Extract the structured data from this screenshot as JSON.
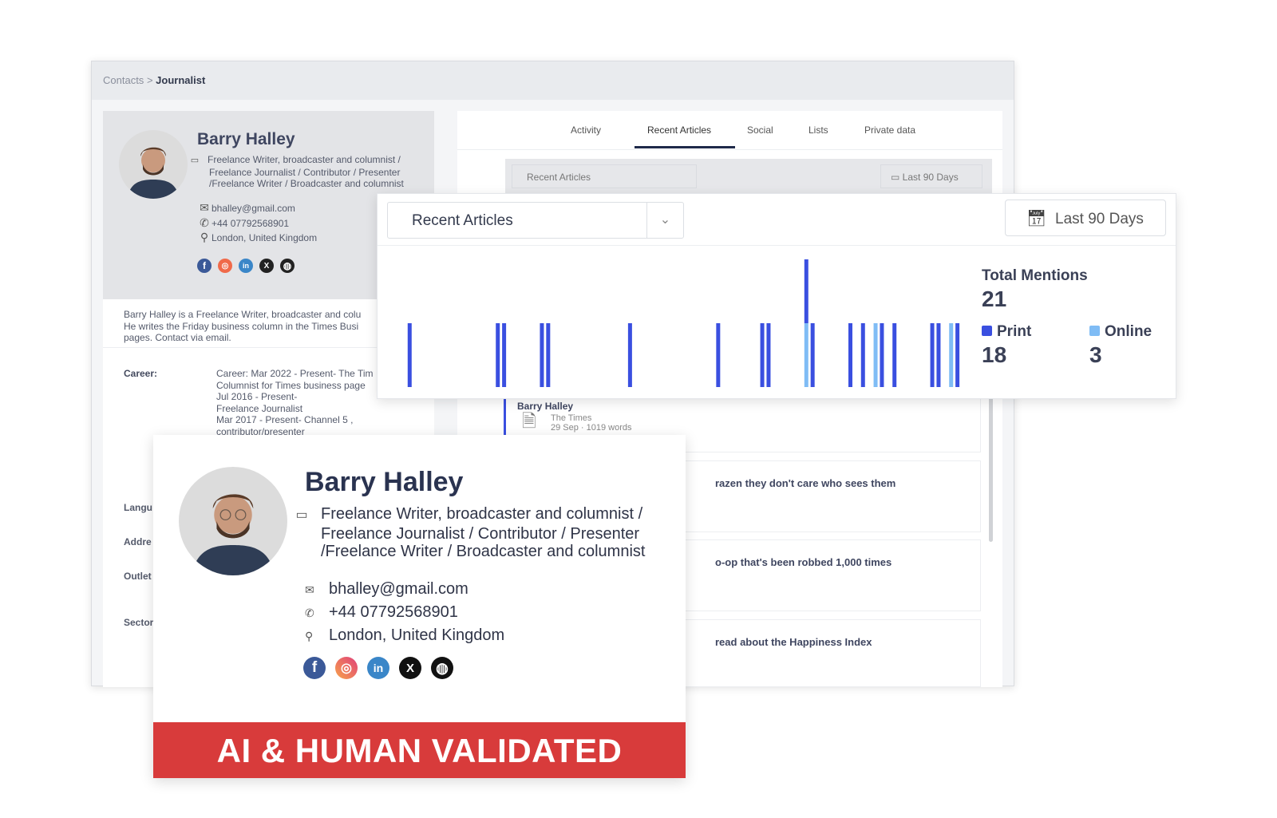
{
  "breadcrumb": {
    "root": "Contacts",
    "current": "Journalist"
  },
  "profile": {
    "name": "Barry Halley",
    "role": "Freelance Writer, broadcaster and columnist / Freelance Journalist / Contributor / Presenter /Freelance Writer / Broadcaster and columnist",
    "email": "bhalley@gmail.com",
    "phone": "+44 07792568901",
    "location": "London, United Kingdom",
    "socials": [
      "facebook",
      "instagram",
      "linkedin",
      "x",
      "website"
    ],
    "bio": "Barry Halley is a Freelance Writer, broadcaster and colu He writes the Friday business column in the Times Busi pages. Contact via email.",
    "career_label": "Career:",
    "career": [
      "Career: Mar 2022 - Present- The Tim",
      "Columnist for Times business page",
      "Jul 2016 - Present-",
      "Freelance Journalist",
      "Mar 2017 - Present- Channel 5 ,",
      "contributor/presenter"
    ],
    "fields": [
      "Langu",
      "Addre",
      "Outlet",
      "Sector"
    ]
  },
  "card_role": "Freelance Writer, broadcaster and columnist / Freelance Journalist / Contributor / Presenter /Freelance Writer / Broadcaster and columnist",
  "tabs": [
    {
      "label": "Activity"
    },
    {
      "label": "Recent Articles",
      "active": true
    },
    {
      "label": "Social"
    },
    {
      "label": "Lists"
    },
    {
      "label": "Private data"
    }
  ],
  "toolbar": {
    "select": "Recent Articles",
    "range": "Last 90 Days"
  },
  "articles": [
    {
      "author": "Barry Halley",
      "outlet": "The Times",
      "meta": "29 Sep · 1019 words"
    },
    {
      "title": "razen they don't care who sees them"
    },
    {
      "title": "o-op that's been robbed 1,000 times"
    },
    {
      "title": "read about the Happiness Index"
    }
  ],
  "banner": "AI & HUMAN VALIDATED",
  "colors": {
    "print": "#3a4fe0",
    "online": "#7fbcf5",
    "banner": "#d83b3b"
  },
  "chart_data": {
    "type": "bar",
    "stacked": true,
    "xlim": [
      0,
      90
    ],
    "series": [
      {
        "name": "Print",
        "days": [
          2,
          16,
          17,
          23,
          24,
          37,
          51,
          58,
          59,
          65,
          66,
          72,
          74,
          77,
          79,
          85,
          86,
          89
        ]
      },
      {
        "name": "Online",
        "days": [
          65,
          76,
          88
        ]
      }
    ],
    "summary": {
      "total_label": "Total Mentions",
      "total": "21",
      "print_label": "Print",
      "print": "18",
      "online_label": "Online",
      "online": "3"
    }
  }
}
